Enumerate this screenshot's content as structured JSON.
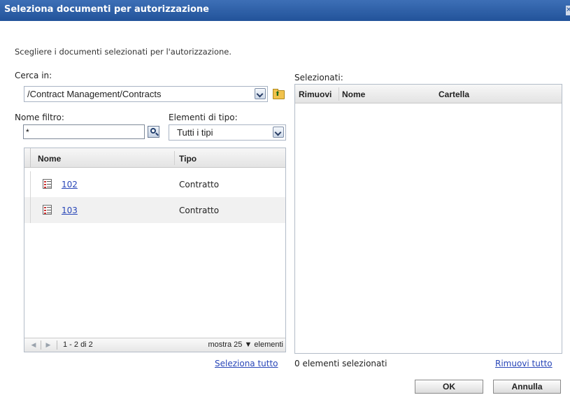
{
  "dialog": {
    "title": "Seleziona documenti per autorizzazione",
    "instruction": "Scegliere i documenti selezionati per l'autorizzazione."
  },
  "search": {
    "label": "Cerca in:",
    "path": "/Contract Management/Contracts"
  },
  "filter": {
    "label": "Nome filtro:",
    "value": "*"
  },
  "type_filter": {
    "label": "Elementi di tipo:",
    "value": "Tutti i tipi"
  },
  "list": {
    "columns": {
      "name": "Nome",
      "type": "Tipo"
    },
    "rows": [
      {
        "name": "102",
        "type": "Contratto"
      },
      {
        "name": "103",
        "type": "Contratto"
      }
    ],
    "pager": {
      "range": "1 - 2 di 2",
      "show_prefix": "mostra",
      "page_size": "25",
      "show_suffix": "elementi"
    },
    "select_all": "Seleziona tutto"
  },
  "selected": {
    "label": "Selezionati:",
    "columns": {
      "remove": "Rimuovi",
      "name": "Nome",
      "folder": "Cartella"
    },
    "count_text": "0 elementi selezionati",
    "remove_all": "Rimuovi tutto"
  },
  "buttons": {
    "ok": "OK",
    "cancel": "Annulla"
  }
}
